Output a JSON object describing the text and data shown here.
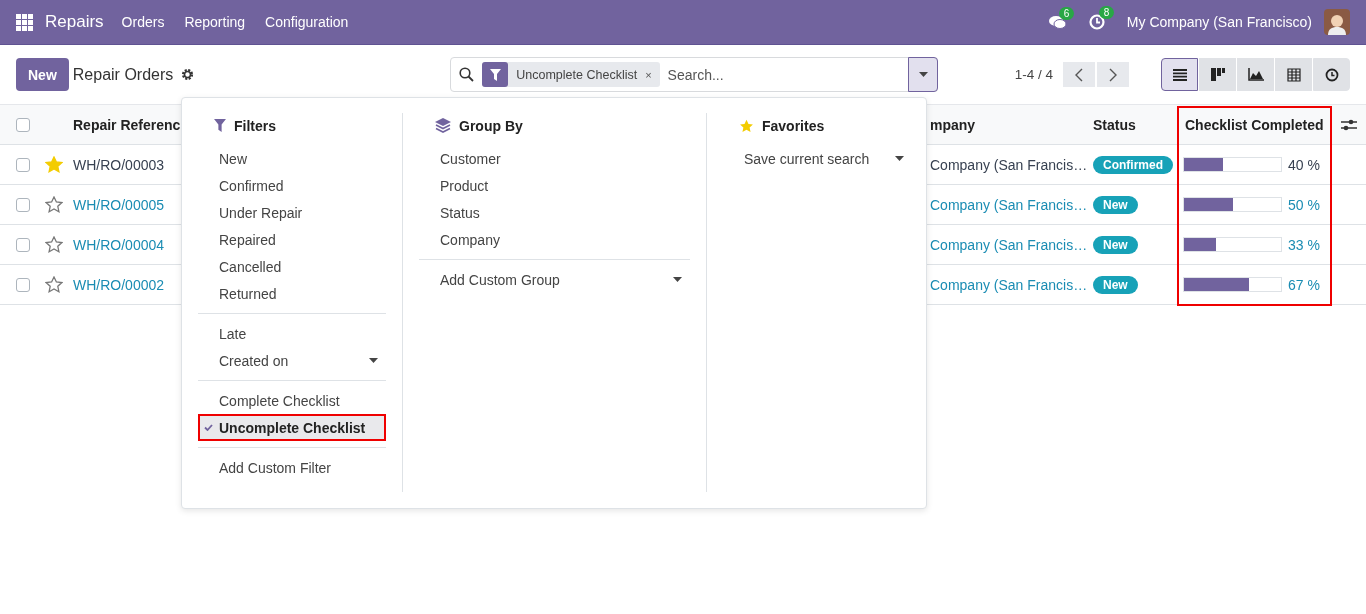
{
  "navbar": {
    "app": "Repairs",
    "menu": [
      "Orders",
      "Reporting",
      "Configuration"
    ],
    "messages_badge": "6",
    "activity_badge": "8",
    "company": "My Company (San Francisco)"
  },
  "control_panel": {
    "new_button": "New",
    "title": "Repair Orders",
    "facet": "Uncomplete Checklist",
    "facet_remove": "×",
    "search_placeholder": "Search...",
    "pager": "1-4 / 4",
    "views": [
      {
        "kind": "list",
        "selected": true
      },
      {
        "kind": "kanban",
        "selected": false
      },
      {
        "kind": "graph",
        "selected": false
      },
      {
        "kind": "pivot",
        "selected": false
      },
      {
        "kind": "activity",
        "selected": false
      }
    ]
  },
  "table": {
    "select_all_checked": false,
    "columns": [
      {
        "label": "Repair Referenc"
      },
      {
        "label": "mpany"
      },
      {
        "label": "Status"
      },
      {
        "label": "Checklist Completed",
        "highlighted": true
      }
    ],
    "rows": [
      {
        "checked": false,
        "starred": true,
        "hovered": true,
        "reference": "WH/RO/00003",
        "company": "Company (San Francis…",
        "status": "Confirmed",
        "level": 0.4,
        "percent": "40 %"
      },
      {
        "checked": false,
        "starred": false,
        "hovered": false,
        "reference": "WH/RO/00005",
        "company": "Company (San Francis…",
        "status": "New",
        "level": 0.5,
        "percent": "50 %"
      },
      {
        "checked": false,
        "starred": false,
        "hovered": false,
        "reference": "WH/RO/00004",
        "company": "Company (San Francis…",
        "status": "New",
        "level": 0.33,
        "percent": "33 %"
      },
      {
        "checked": false,
        "starred": false,
        "hovered": false,
        "reference": "WH/RO/00002",
        "company": "Company (San Francis…",
        "status": "New",
        "level": 0.67,
        "percent": "67 %"
      }
    ]
  },
  "dropdown": {
    "filters": {
      "title": "Filters",
      "groups": [
        [
          {
            "label": "New",
            "selected": false,
            "has_submenu": false,
            "highlighted": false
          },
          {
            "label": "Confirmed",
            "selected": false,
            "has_submenu": false,
            "highlighted": false
          },
          {
            "label": "Under Repair",
            "selected": false,
            "has_submenu": false,
            "highlighted": false
          },
          {
            "label": "Repaired",
            "selected": false,
            "has_submenu": false,
            "highlighted": false
          },
          {
            "label": "Cancelled",
            "selected": false,
            "has_submenu": false,
            "highlighted": false
          },
          {
            "label": "Returned",
            "selected": false,
            "has_submenu": false,
            "highlighted": false
          }
        ],
        [
          {
            "label": "Late",
            "selected": false,
            "has_submenu": false,
            "highlighted": false
          },
          {
            "label": "Created on",
            "selected": false,
            "has_submenu": true,
            "highlighted": false
          }
        ],
        [
          {
            "label": "Complete Checklist",
            "selected": false,
            "has_submenu": false,
            "highlighted": false
          },
          {
            "label": "Uncomplete Checklist",
            "selected": true,
            "has_submenu": false,
            "highlighted": true
          }
        ],
        [
          {
            "label": "Add Custom Filter",
            "selected": false,
            "has_submenu": false,
            "highlighted": false
          }
        ]
      ]
    },
    "group_by": {
      "title": "Group By",
      "groups": [
        [
          {
            "label": "Customer",
            "selected": false,
            "has_submenu": false,
            "highlighted": false
          },
          {
            "label": "Product",
            "selected": false,
            "has_submenu": false,
            "highlighted": false
          },
          {
            "label": "Status",
            "selected": false,
            "has_submenu": false,
            "highlighted": false
          },
          {
            "label": "Company",
            "selected": false,
            "has_submenu": false,
            "highlighted": false
          }
        ],
        [
          {
            "label": "Add Custom Group",
            "selected": false,
            "has_submenu": true,
            "highlighted": false
          }
        ]
      ]
    },
    "favorites": {
      "title": "Favorites",
      "groups": [
        [
          {
            "label": "Save current search",
            "selected": false,
            "has_submenu": true,
            "highlighted": false
          }
        ]
      ]
    }
  }
}
